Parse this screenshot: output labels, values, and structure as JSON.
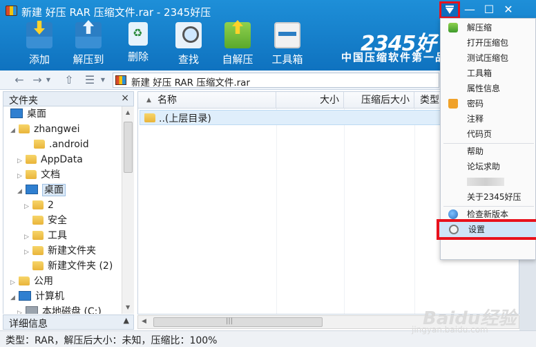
{
  "window": {
    "title": "新建 好压 RAR 压缩文件.rar - 2345好压",
    "controls": {
      "menu": "▾",
      "minimize": "—",
      "maximize": "☐",
      "close": "✕"
    }
  },
  "toolbar": {
    "items": [
      {
        "label": "添加",
        "icon": "add-icon"
      },
      {
        "label": "解压到",
        "icon": "extract-icon"
      },
      {
        "label": "删除",
        "icon": "recycle-icon"
      },
      {
        "label": "查找",
        "icon": "search-icon"
      },
      {
        "label": "自解压",
        "icon": "sfx-icon"
      },
      {
        "label": "工具箱",
        "icon": "toolbox-icon"
      }
    ],
    "brand": "2345好",
    "slogan": "中国压缩软件第一品"
  },
  "nav": {
    "back": "←",
    "forward": "→",
    "up": "⇧",
    "view": "☰",
    "path": "新建 好压 RAR 压缩文件.rar"
  },
  "sidebar": {
    "title": "文件夹",
    "close": "×",
    "tree": [
      {
        "label": "桌面",
        "icon": "desktop"
      },
      {
        "label": "zhangwei",
        "icon": "user-folder"
      },
      {
        "label": ".android",
        "icon": "folder"
      },
      {
        "label": "AppData",
        "icon": "folder"
      },
      {
        "label": "文档",
        "icon": "documents"
      },
      {
        "label": "桌面",
        "icon": "desktop"
      },
      {
        "label": "2",
        "icon": "folder"
      },
      {
        "label": "安全",
        "icon": "folder"
      },
      {
        "label": "工具",
        "icon": "folder"
      },
      {
        "label": "新建文件夹",
        "icon": "folder"
      },
      {
        "label": "新建文件夹 (2)",
        "icon": "folder"
      },
      {
        "label": "公用",
        "icon": "folder"
      },
      {
        "label": "计算机",
        "icon": "computer"
      },
      {
        "label": "本地磁盘 (C:)",
        "icon": "drive"
      }
    ],
    "details_title": "详细信息",
    "details_toggle": "▲"
  },
  "list": {
    "columns": [
      "名称",
      "大小",
      "压缩后大小",
      "类型"
    ],
    "rows": [
      {
        "name": "..(上层目录)"
      }
    ]
  },
  "status": {
    "text": "类型：RAR，解压后大小：未知，压缩比：100%"
  },
  "menu": {
    "items": [
      "解压缩",
      "打开压缩包",
      "测试压缩包",
      "工具箱",
      "属性信息",
      "密码",
      "注释",
      "代码页",
      "帮助",
      "论坛求助",
      "关于2345好压",
      "检查新版本",
      "设置"
    ]
  },
  "watermark": {
    "logo": "Baidu经验",
    "url": "jingyan.baidu.com"
  },
  "colors": {
    "titlebar": "#1582d0",
    "highlight": "#e8111c",
    "selection": "#dfeefb"
  }
}
